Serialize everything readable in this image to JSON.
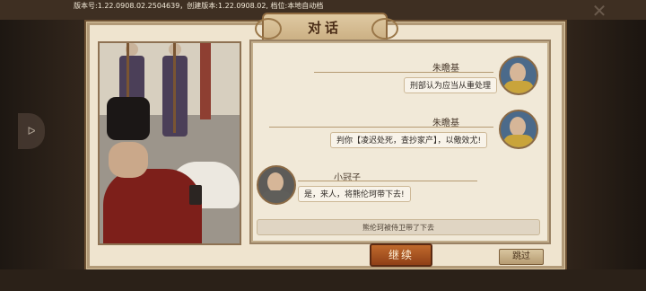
{
  "header": {
    "version_text": "版本号:1.22.0908.02.2504639，创建版本:1.22.0908.02, 档位:本地自动档",
    "close_symbol": "✕"
  },
  "side_handle": {
    "symbol": "ᐅ"
  },
  "dialog": {
    "title": "对话",
    "messages": [
      {
        "speaker": "朱瞻基",
        "text": "刑部认为应当从重处理",
        "side": "right"
      },
      {
        "speaker": "朱瞻基",
        "text": "判你【凌迟处死，查抄家产】，以儆效尤!",
        "side": "right"
      },
      {
        "speaker": "小冠子",
        "text": "是，来人，将熊伦珂带下去!",
        "side": "left"
      }
    ],
    "narration": "熊伦珂被侍卫带了下去"
  },
  "buttons": {
    "continue": "继续",
    "skip": "跳过"
  },
  "colors": {
    "continue_button": "#a9521f",
    "panel_bg": "#efe4cf",
    "accent_brown": "#6e5234"
  }
}
